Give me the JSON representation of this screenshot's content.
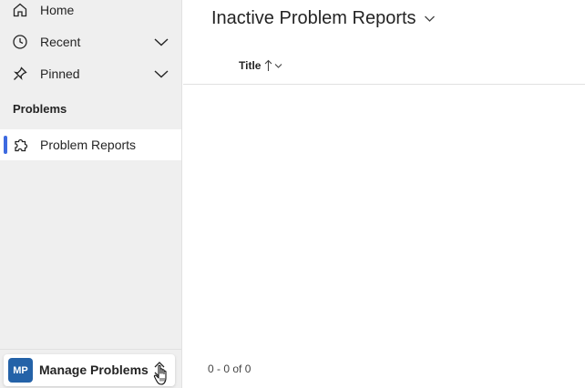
{
  "sidebar": {
    "items": [
      {
        "label": "Home",
        "icon": "home-icon"
      },
      {
        "label": "Recent",
        "icon": "clock-icon"
      },
      {
        "label": "Pinned",
        "icon": "pin-icon"
      }
    ],
    "section_title": "Problems",
    "section_items": [
      {
        "label": "Problem Reports",
        "icon": "puzzle-icon",
        "selected": true
      }
    ],
    "area_switcher": {
      "avatar_initials": "MP",
      "label": "Manage Problems"
    }
  },
  "main": {
    "view_title": "Inactive Problem Reports",
    "columns": [
      {
        "label": "Title",
        "sort": "ascending"
      }
    ],
    "rows": [],
    "paging_text": "0 - 0 of 0"
  },
  "colors": {
    "accent": "#3d6ae0",
    "avatar": "#2462a8",
    "sidebar_bg": "#efefef"
  }
}
